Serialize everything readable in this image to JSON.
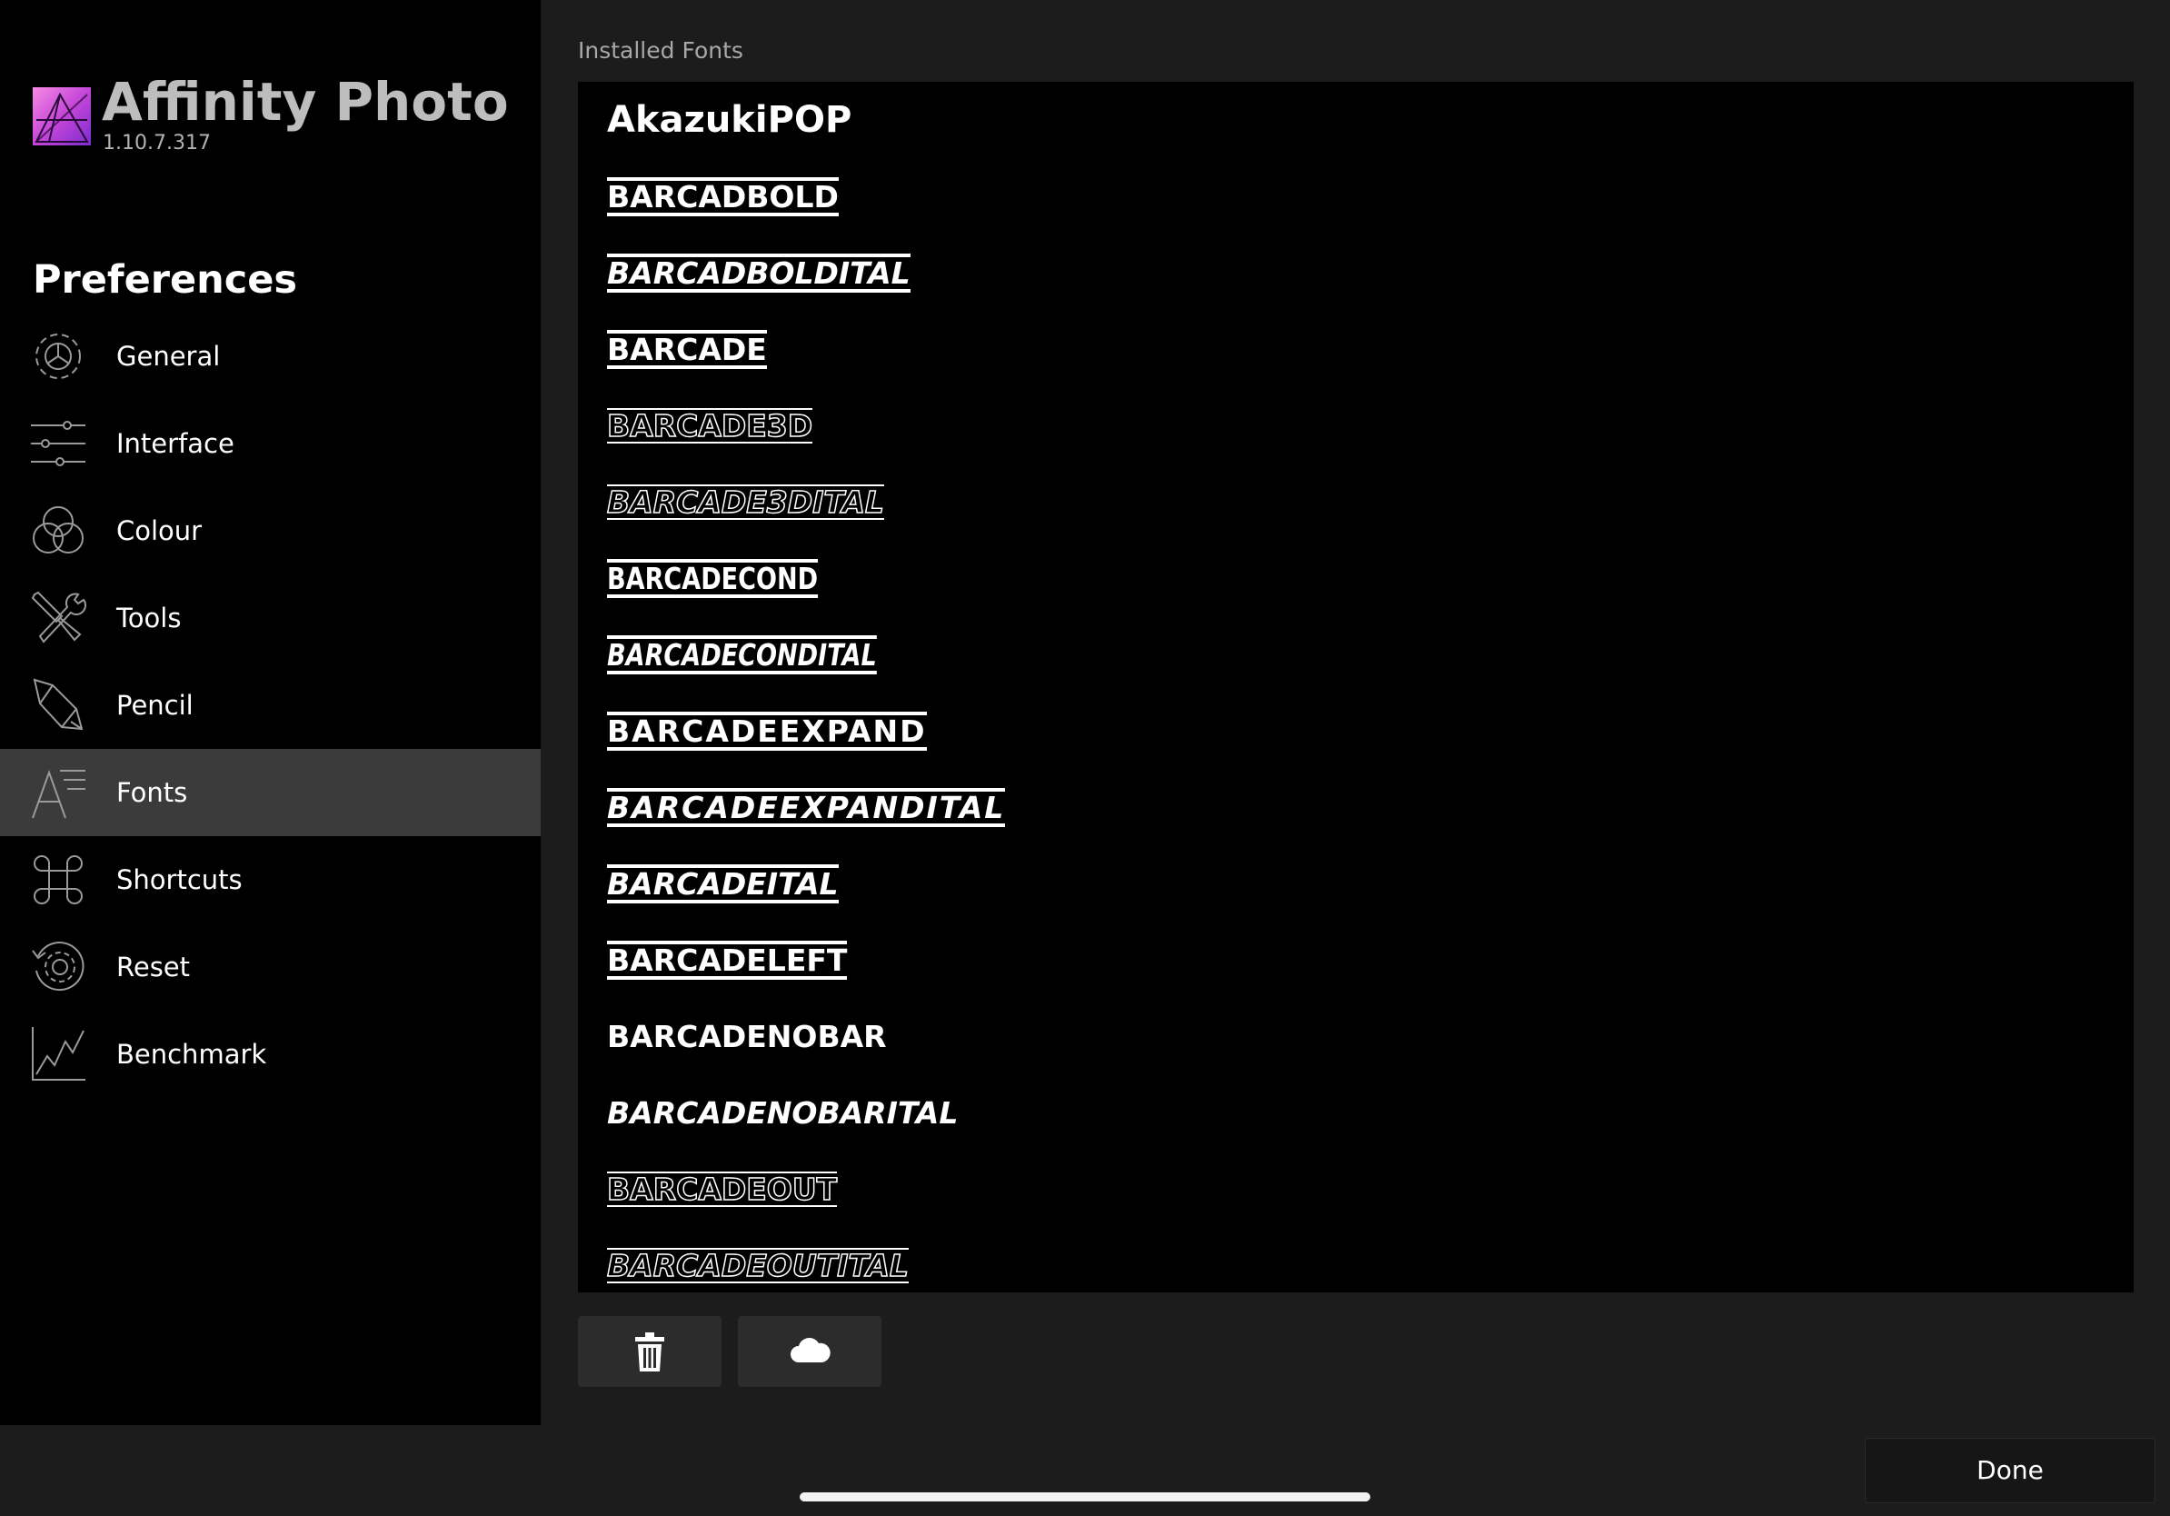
{
  "app": {
    "name": "Affinity Photo",
    "version": "1.10.7.317",
    "logo_icon": "affinity-photo-logo",
    "logo_colors": [
      "#f46fde",
      "#b53cd1",
      "#7c2bd0"
    ]
  },
  "sidebar": {
    "title": "Preferences",
    "items": [
      {
        "label": "General",
        "icon": "gear-icon"
      },
      {
        "label": "Interface",
        "icon": "sliders-icon"
      },
      {
        "label": "Colour",
        "icon": "colour-circles-icon"
      },
      {
        "label": "Tools",
        "icon": "tools-icon"
      },
      {
        "label": "Pencil",
        "icon": "pencil-icon"
      },
      {
        "label": "Fonts",
        "icon": "fonts-icon",
        "selected": true
      },
      {
        "label": "Shortcuts",
        "icon": "command-icon"
      },
      {
        "label": "Reset",
        "icon": "reset-icon"
      },
      {
        "label": "Benchmark",
        "icon": "benchmark-chart-icon"
      }
    ]
  },
  "main": {
    "section_title": "Installed Fonts",
    "fonts": [
      {
        "name": "AkazukiPOP",
        "style": "plain"
      },
      {
        "name": "BARCADBOLD",
        "style": "bar"
      },
      {
        "name": "BARCADBOLDITAL",
        "style": "bar-ital"
      },
      {
        "name": "BARCADE",
        "style": "bar"
      },
      {
        "name": "BARCADE3D",
        "style": "outline"
      },
      {
        "name": "BARCADE3DITAL",
        "style": "outline-ital"
      },
      {
        "name": "BARCADECOND",
        "style": "bar-cond"
      },
      {
        "name": "BARCADECONDITAL",
        "style": "bar-cond-ital"
      },
      {
        "name": "BARCADEEXPAND",
        "style": "bar-exp"
      },
      {
        "name": "BARCADEEXPANDITAL",
        "style": "bar-exp-ital"
      },
      {
        "name": "BARCADEITAL",
        "style": "bar-ital"
      },
      {
        "name": "BARCADELEFT",
        "style": "bar"
      },
      {
        "name": "BARCADENOBAR",
        "style": "nobar"
      },
      {
        "name": "BARCADENOBARITAL",
        "style": "nobar-ital"
      },
      {
        "name": "BARCADEOUT",
        "style": "outline"
      },
      {
        "name": "BARCADEOUTITAL",
        "style": "outline-ital"
      }
    ],
    "buttons": [
      {
        "name": "delete-font-button",
        "icon": "trash-icon"
      },
      {
        "name": "cloud-font-button",
        "icon": "cloud-icon"
      }
    ]
  },
  "footer": {
    "done_label": "Done"
  }
}
